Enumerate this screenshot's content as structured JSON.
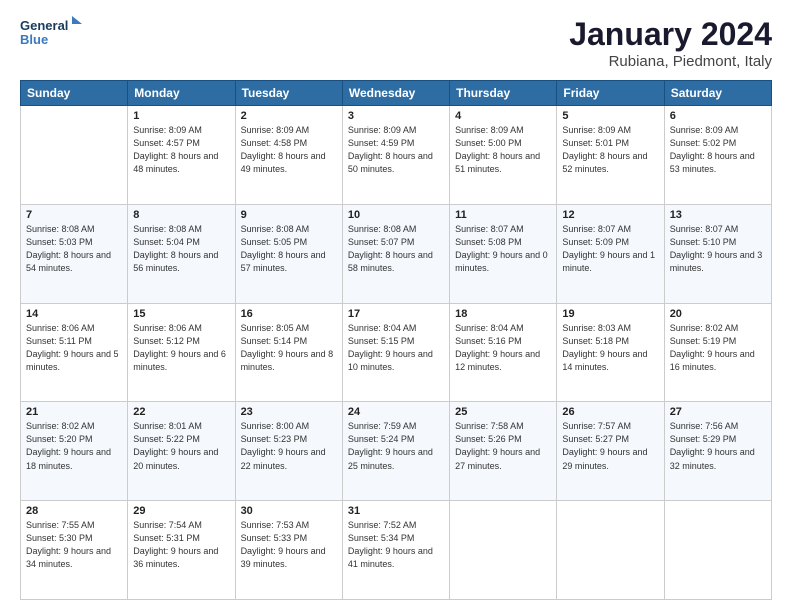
{
  "header": {
    "logo_line1": "General",
    "logo_line2": "Blue",
    "title": "January 2024",
    "subtitle": "Rubiana, Piedmont, Italy"
  },
  "weekdays": [
    "Sunday",
    "Monday",
    "Tuesday",
    "Wednesday",
    "Thursday",
    "Friday",
    "Saturday"
  ],
  "weeks": [
    [
      {
        "day": null,
        "sunrise": null,
        "sunset": null,
        "daylight": null
      },
      {
        "day": "1",
        "sunrise": "8:09 AM",
        "sunset": "4:57 PM",
        "daylight": "8 hours and 48 minutes."
      },
      {
        "day": "2",
        "sunrise": "8:09 AM",
        "sunset": "4:58 PM",
        "daylight": "8 hours and 49 minutes."
      },
      {
        "day": "3",
        "sunrise": "8:09 AM",
        "sunset": "4:59 PM",
        "daylight": "8 hours and 50 minutes."
      },
      {
        "day": "4",
        "sunrise": "8:09 AM",
        "sunset": "5:00 PM",
        "daylight": "8 hours and 51 minutes."
      },
      {
        "day": "5",
        "sunrise": "8:09 AM",
        "sunset": "5:01 PM",
        "daylight": "8 hours and 52 minutes."
      },
      {
        "day": "6",
        "sunrise": "8:09 AM",
        "sunset": "5:02 PM",
        "daylight": "8 hours and 53 minutes."
      }
    ],
    [
      {
        "day": "7",
        "sunrise": "8:08 AM",
        "sunset": "5:03 PM",
        "daylight": "8 hours and 54 minutes."
      },
      {
        "day": "8",
        "sunrise": "8:08 AM",
        "sunset": "5:04 PM",
        "daylight": "8 hours and 56 minutes."
      },
      {
        "day": "9",
        "sunrise": "8:08 AM",
        "sunset": "5:05 PM",
        "daylight": "8 hours and 57 minutes."
      },
      {
        "day": "10",
        "sunrise": "8:08 AM",
        "sunset": "5:07 PM",
        "daylight": "8 hours and 58 minutes."
      },
      {
        "day": "11",
        "sunrise": "8:07 AM",
        "sunset": "5:08 PM",
        "daylight": "9 hours and 0 minutes."
      },
      {
        "day": "12",
        "sunrise": "8:07 AM",
        "sunset": "5:09 PM",
        "daylight": "9 hours and 1 minute."
      },
      {
        "day": "13",
        "sunrise": "8:07 AM",
        "sunset": "5:10 PM",
        "daylight": "9 hours and 3 minutes."
      }
    ],
    [
      {
        "day": "14",
        "sunrise": "8:06 AM",
        "sunset": "5:11 PM",
        "daylight": "9 hours and 5 minutes."
      },
      {
        "day": "15",
        "sunrise": "8:06 AM",
        "sunset": "5:12 PM",
        "daylight": "9 hours and 6 minutes."
      },
      {
        "day": "16",
        "sunrise": "8:05 AM",
        "sunset": "5:14 PM",
        "daylight": "9 hours and 8 minutes."
      },
      {
        "day": "17",
        "sunrise": "8:04 AM",
        "sunset": "5:15 PM",
        "daylight": "9 hours and 10 minutes."
      },
      {
        "day": "18",
        "sunrise": "8:04 AM",
        "sunset": "5:16 PM",
        "daylight": "9 hours and 12 minutes."
      },
      {
        "day": "19",
        "sunrise": "8:03 AM",
        "sunset": "5:18 PM",
        "daylight": "9 hours and 14 minutes."
      },
      {
        "day": "20",
        "sunrise": "8:02 AM",
        "sunset": "5:19 PM",
        "daylight": "9 hours and 16 minutes."
      }
    ],
    [
      {
        "day": "21",
        "sunrise": "8:02 AM",
        "sunset": "5:20 PM",
        "daylight": "9 hours and 18 minutes."
      },
      {
        "day": "22",
        "sunrise": "8:01 AM",
        "sunset": "5:22 PM",
        "daylight": "9 hours and 20 minutes."
      },
      {
        "day": "23",
        "sunrise": "8:00 AM",
        "sunset": "5:23 PM",
        "daylight": "9 hours and 22 minutes."
      },
      {
        "day": "24",
        "sunrise": "7:59 AM",
        "sunset": "5:24 PM",
        "daylight": "9 hours and 25 minutes."
      },
      {
        "day": "25",
        "sunrise": "7:58 AM",
        "sunset": "5:26 PM",
        "daylight": "9 hours and 27 minutes."
      },
      {
        "day": "26",
        "sunrise": "7:57 AM",
        "sunset": "5:27 PM",
        "daylight": "9 hours and 29 minutes."
      },
      {
        "day": "27",
        "sunrise": "7:56 AM",
        "sunset": "5:29 PM",
        "daylight": "9 hours and 32 minutes."
      }
    ],
    [
      {
        "day": "28",
        "sunrise": "7:55 AM",
        "sunset": "5:30 PM",
        "daylight": "9 hours and 34 minutes."
      },
      {
        "day": "29",
        "sunrise": "7:54 AM",
        "sunset": "5:31 PM",
        "daylight": "9 hours and 36 minutes."
      },
      {
        "day": "30",
        "sunrise": "7:53 AM",
        "sunset": "5:33 PM",
        "daylight": "9 hours and 39 minutes."
      },
      {
        "day": "31",
        "sunrise": "7:52 AM",
        "sunset": "5:34 PM",
        "daylight": "9 hours and 41 minutes."
      },
      {
        "day": null,
        "sunrise": null,
        "sunset": null,
        "daylight": null
      },
      {
        "day": null,
        "sunrise": null,
        "sunset": null,
        "daylight": null
      },
      {
        "day": null,
        "sunrise": null,
        "sunset": null,
        "daylight": null
      }
    ]
  ]
}
